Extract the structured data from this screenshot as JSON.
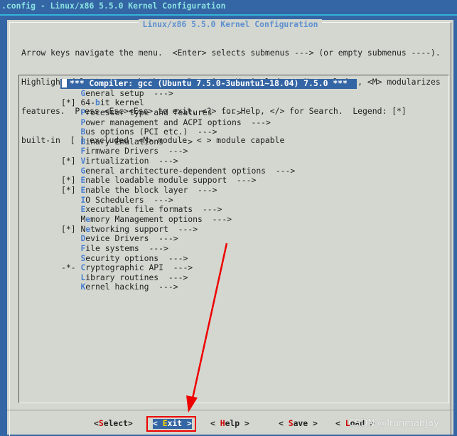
{
  "window_title": ".config - Linux/x86 5.5.0 Kernel Configuration",
  "dialog_title": "Linux/x86 5.5.0 Kernel Configuration",
  "help_lines": [
    "Arrow keys navigate the menu.  <Enter> selects submenus ---> (or empty submenus ----).",
    "Highlighted letters are hotkeys.  Pressing <Y> includes, <N> excludes, <M> modularizes",
    "features.  Press <Esc><Esc> to exit, <?> for Help, </> for Search.  Legend: [*]",
    "built-in  [ ] excluded  <M> module  < > module capable"
  ],
  "menu_items": [
    {
      "prefix": "   ",
      "label": "*** Compiler: gcc (Ubuntu 7.5.0-3ubuntu1~18.04) 7.5.0 ***",
      "hotkey": -1,
      "selected": true
    },
    {
      "prefix": "   ",
      "label": "General setup  --->",
      "hotkey": 0
    },
    {
      "prefix": "[*]",
      "label": "64-bit kernel",
      "hotkey": 3
    },
    {
      "prefix": "   ",
      "label": "Processor type and features  --->",
      "hotkey": 0
    },
    {
      "prefix": "   ",
      "label": "Power management and ACPI options  --->",
      "hotkey": 0
    },
    {
      "prefix": "   ",
      "label": "Bus options (PCI etc.)  --->",
      "hotkey": 0
    },
    {
      "prefix": "   ",
      "label": "Binary Emulations  --->",
      "hotkey": 0
    },
    {
      "prefix": "   ",
      "label": "Firmware Drivers  --->",
      "hotkey": 0
    },
    {
      "prefix": "[*]",
      "label": "Virtualization  --->",
      "hotkey": 0
    },
    {
      "prefix": "   ",
      "label": "General architecture-dependent options  --->",
      "hotkey": 0
    },
    {
      "prefix": "[*]",
      "label": "Enable loadable module support  --->",
      "hotkey": 0
    },
    {
      "prefix": "[*]",
      "label": "Enable the block layer  --->",
      "hotkey": 0
    },
    {
      "prefix": "   ",
      "label": "IO Schedulers  --->",
      "hotkey": 0
    },
    {
      "prefix": "   ",
      "label": "Executable file formats  --->",
      "hotkey": 0
    },
    {
      "prefix": "   ",
      "label": "Memory Management options  --->",
      "hotkey": 1
    },
    {
      "prefix": "[*]",
      "label": "Networking support  --->",
      "hotkey": 1
    },
    {
      "prefix": "   ",
      "label": "Device Drivers  --->",
      "hotkey": 0
    },
    {
      "prefix": "   ",
      "label": "File systems  --->",
      "hotkey": 0
    },
    {
      "prefix": "   ",
      "label": "Security options  --->",
      "hotkey": 0
    },
    {
      "prefix": "-*-",
      "label": "Cryptographic API  --->",
      "hotkey": 0
    },
    {
      "prefix": "   ",
      "label": "Library routines  --->",
      "hotkey": 0
    },
    {
      "prefix": "   ",
      "label": "Kernel hacking  --->",
      "hotkey": 0
    }
  ],
  "buttons": [
    {
      "label": "<Select>",
      "hotkey": 1,
      "selected": false
    },
    {
      "label": "< Exit >",
      "hotkey": 2,
      "selected": true
    },
    {
      "label": "< Help >",
      "hotkey": 2,
      "selected": false
    },
    {
      "label": "< Save >",
      "hotkey": 2,
      "selected": false
    },
    {
      "label": "< Load >",
      "hotkey": 2,
      "selected": false
    }
  ],
  "watermark": "CSDN @IronmanJay",
  "colors": {
    "background": "#3465a4",
    "dialog": "#d3d7cf",
    "hotkey": "#4a7fd0",
    "button_hotkey": "#cc0000",
    "annotation": "#ee0000"
  }
}
